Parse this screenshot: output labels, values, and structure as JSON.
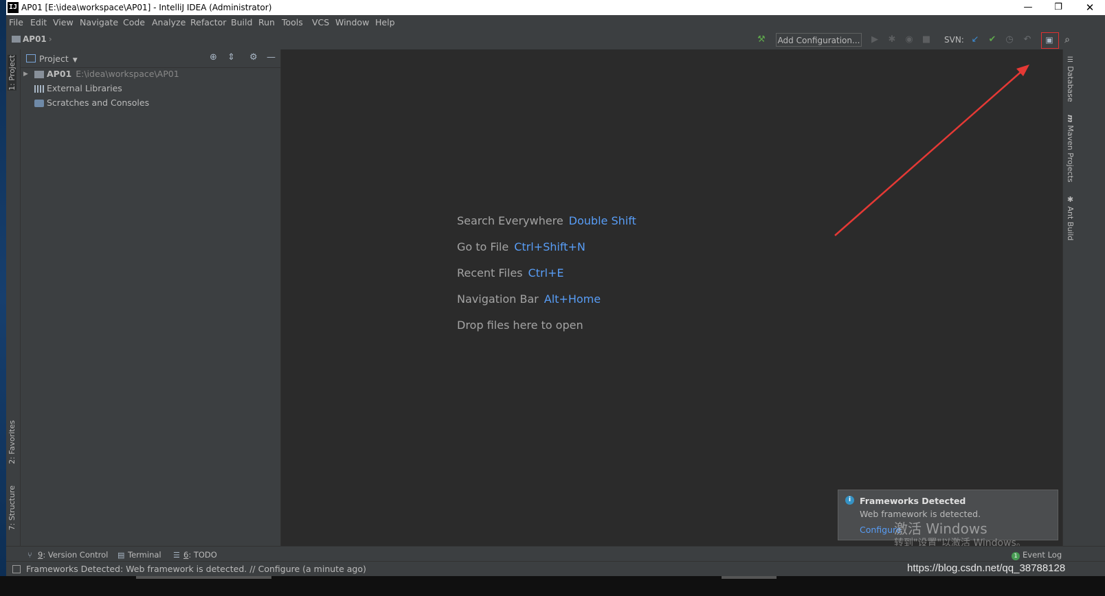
{
  "window": {
    "title": "AP01 [E:\\idea\\workspace\\AP01] - IntelliJ IDEA (Administrator)",
    "icon_text": "IJ",
    "minimize": "—",
    "maximize": "❐",
    "close": "✕"
  },
  "menu": [
    "File",
    "Edit",
    "View",
    "Navigate",
    "Code",
    "Analyze",
    "Refactor",
    "Build",
    "Run",
    "Tools",
    "VCS",
    "Window",
    "Help"
  ],
  "navbar": {
    "project": "AP01",
    "add_configuration": "Add Configuration...",
    "svn_label": "SVN:"
  },
  "left_tabs": {
    "project": "1: Project",
    "favorites": "2: Favorites",
    "structure": "7: Structure"
  },
  "right_tabs": {
    "database": "Database",
    "maven": "Maven Projects",
    "ant": "Ant Build"
  },
  "project_panel": {
    "title": "Project",
    "tree": [
      {
        "label": "AP01",
        "path": "E:\\idea\\workspace\\AP01"
      },
      {
        "label": "External Libraries"
      },
      {
        "label": "Scratches and Consoles"
      }
    ]
  },
  "editor_hints": [
    {
      "text": "Search Everywhere",
      "key": "Double Shift"
    },
    {
      "text": "Go to File",
      "key": "Ctrl+Shift+N"
    },
    {
      "text": "Recent Files",
      "key": "Ctrl+E"
    },
    {
      "text": "Navigation Bar",
      "key": "Alt+Home"
    },
    {
      "text": "Drop files here to open",
      "key": ""
    }
  ],
  "notification": {
    "title": "Frameworks Detected",
    "body": "Web framework is detected.",
    "link": "Configure"
  },
  "watermark": {
    "line1": "激活 Windows",
    "line2": "转到\"设置\"以激活 Windows。"
  },
  "bottom_tools": {
    "version_control": {
      "mnemonic": "9",
      "label": ": Version Control"
    },
    "terminal": {
      "label": "Terminal"
    },
    "todo": {
      "mnemonic": "6",
      "label": ": TODO"
    },
    "event_log": {
      "badge": "1",
      "label": "Event Log"
    }
  },
  "status": {
    "message": "Frameworks Detected: Web framework is detected. // Configure (a minute ago)",
    "url": "https://blog.csdn.net/qq_38788128"
  },
  "colors": {
    "accent_blue": "#589df6",
    "highlight_red": "#e03030",
    "editor_bg": "#2b2b2b",
    "panel_bg": "#3c3f41"
  }
}
